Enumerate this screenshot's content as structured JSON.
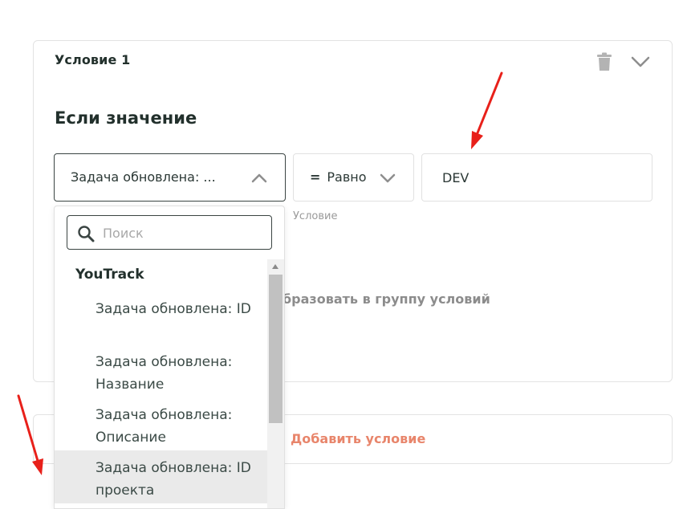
{
  "condition": {
    "title": "Условие 1",
    "section_title": "Если значение",
    "field_value": "Задача обновлена: ...",
    "operator_symbol": "=",
    "operator_label": "Равно",
    "operator_caption": "Условие",
    "value": "DEV",
    "group_link_label": "бразовать в группу условий"
  },
  "add_condition": {
    "plus": "+",
    "label": "Добавить условие"
  },
  "dropdown": {
    "search_placeholder": "Поиск",
    "group_label": "YouTrack",
    "options": [
      "Задача обновлена: ID",
      "Задача обновлена: Название",
      "Задача обновлена: Описание",
      "Задача обновлена: ID проекта"
    ],
    "highlighted_option_index": 3
  },
  "icons": {
    "delete": "trash-icon",
    "collapse": "chevron-down-icon",
    "open_select": "chevron-up-icon",
    "operator_select": "chevron-down-icon",
    "search": "search-icon"
  },
  "colors": {
    "accent": "#e8856b",
    "annotation_arrow": "#e8201a",
    "highlight_row": "#eaeaea"
  }
}
